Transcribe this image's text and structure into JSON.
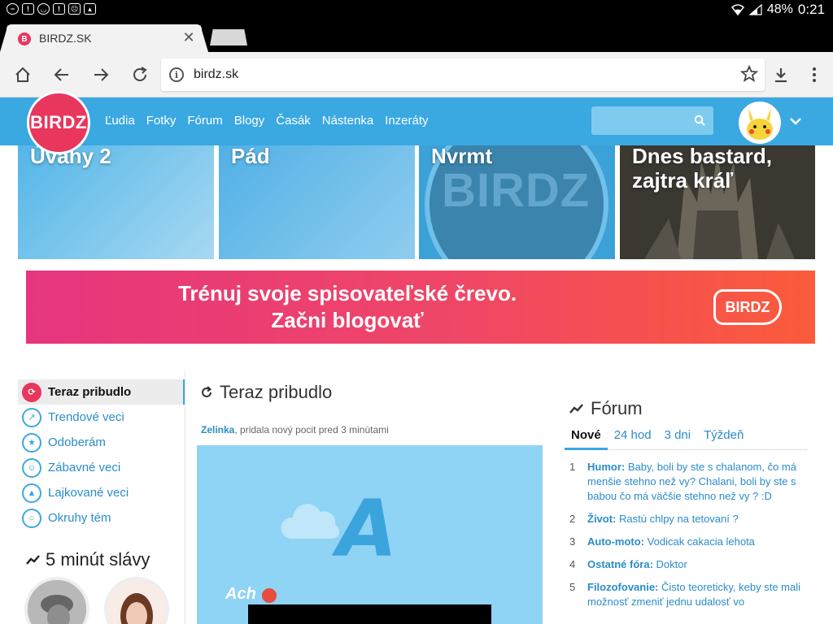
{
  "statusbar": {
    "battery": "48%",
    "time": "0:21"
  },
  "browser": {
    "tab_title": "BIRDZ.SK",
    "tab_favicon": "B",
    "url": "birdz.sk"
  },
  "site": {
    "logo": "BIRDZ",
    "nav": [
      "Ľudia",
      "Fotky",
      "Fórum",
      "Blogy",
      "Časák",
      "Nástenka",
      "Inzeráty"
    ],
    "search_placeholder": ""
  },
  "tiles": [
    {
      "title": "Úvahy 2"
    },
    {
      "title": "Pád"
    },
    {
      "title": "Nvrmt",
      "logo": "BIRDZ"
    },
    {
      "title": "Dnes bastard, zajtra kráľ"
    }
  ],
  "banner": {
    "line1": "Trénuj svoje spisovateľské črevo.",
    "line2": "Začni blogovať",
    "logo": "BIRDZ"
  },
  "sidebar": {
    "items": [
      {
        "label": "Teraz pribudlo",
        "icon": "refresh-icon",
        "active": true
      },
      {
        "label": "Trendové veci",
        "icon": "trend-icon",
        "active": false
      },
      {
        "label": "Odoberám",
        "icon": "star-icon",
        "active": false
      },
      {
        "label": "Zábavné veci",
        "icon": "smile-icon",
        "active": false
      },
      {
        "label": "Lajkované veci",
        "icon": "thumb-up-icon",
        "active": false
      },
      {
        "label": "Okruhy tém",
        "icon": "circle-icon",
        "active": false
      }
    ],
    "fame_title": "5 minút slávy"
  },
  "feed": {
    "title": "Teraz pribudlo",
    "meta_user": "Zelinka",
    "meta_text": ", pridala nový pocit pred 3 minútami",
    "post_letter": "A",
    "post_caption": "Ach"
  },
  "forum": {
    "title": "Fórum",
    "tabs": [
      "Nové",
      "24 hod",
      "3 dni",
      "Týždeň"
    ],
    "items": [
      {
        "num": "1",
        "category": "Humor:",
        "text": "Baby, boli by ste s chalanom, čo má menšie stehno než vy? Chalani, boli by ste s babou čo má väčšie stehno než vy ? :D"
      },
      {
        "num": "2",
        "category": "Život:",
        "text": "Rastú chlpy na tetovaní ?"
      },
      {
        "num": "3",
        "category": "Auto-moto:",
        "text": "Vodicak cakacia lehota"
      },
      {
        "num": "4",
        "category": "Ostatné fóra:",
        "text": "Doktor"
      },
      {
        "num": "5",
        "category": "Filozofovanie:",
        "text": "Čisto teoreticky, keby ste mali možnosť zmeniť jednu udalosť vo"
      }
    ]
  },
  "colors": {
    "brand_blue": "#3aa8e1",
    "brand_red": "#e8365d",
    "link": "#2a8cc8"
  }
}
